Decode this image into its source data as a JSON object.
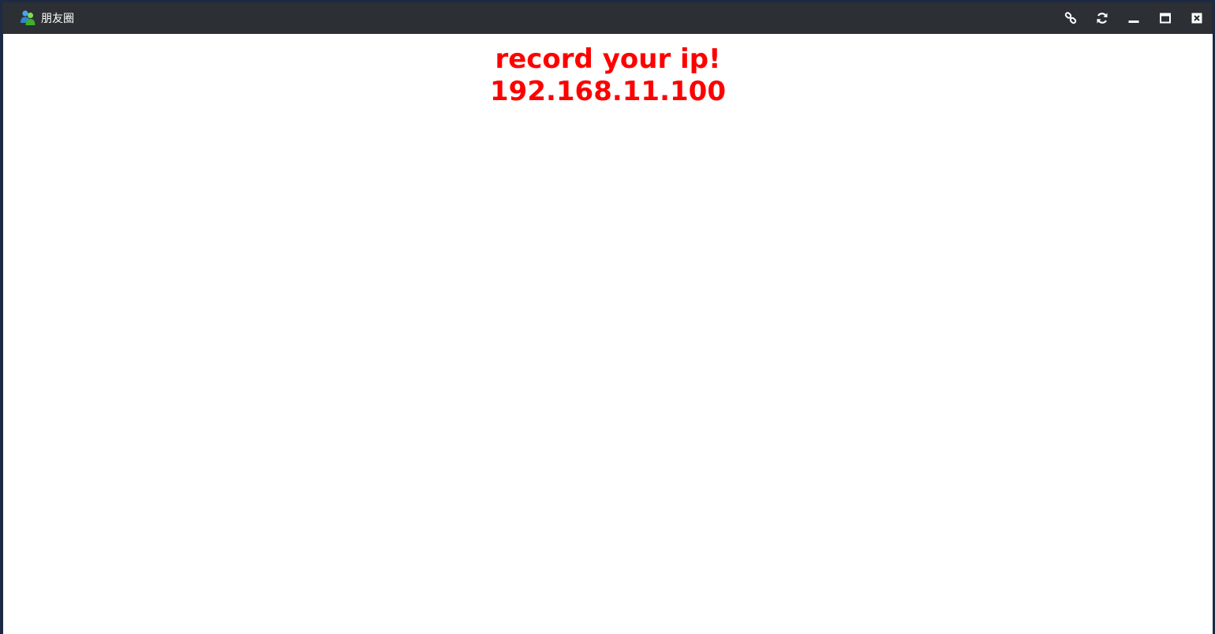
{
  "window": {
    "title": "朋友圈",
    "app_icon": "users-icon",
    "controls": [
      {
        "name": "link-icon",
        "label": "link"
      },
      {
        "name": "refresh-icon",
        "label": "refresh"
      },
      {
        "name": "minimize-icon",
        "label": "minimize"
      },
      {
        "name": "maximize-icon",
        "label": "maximize"
      },
      {
        "name": "close-icon",
        "label": "close"
      }
    ]
  },
  "content": {
    "heading": "record your ip!",
    "ip_address": "192.168.11.100"
  },
  "colors": {
    "titlebar": "#2c2f33",
    "message_text": "#ff0000",
    "content_background": "#ffffff"
  }
}
